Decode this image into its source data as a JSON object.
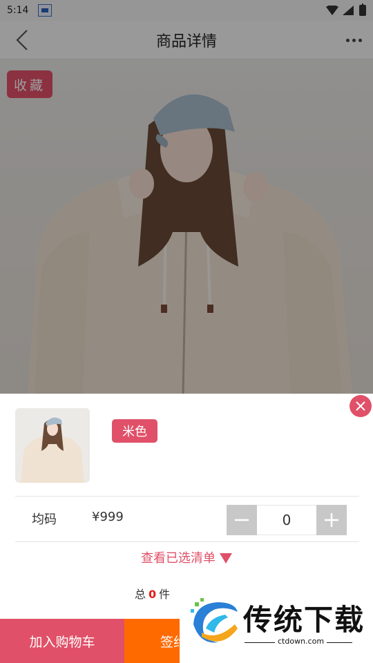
{
  "status_bar": {
    "time": "5:14"
  },
  "nav": {
    "title": "商品详情"
  },
  "hero": {
    "favorite_label": "收藏"
  },
  "sheet": {
    "color_option": "米色",
    "size": "均码",
    "price": "¥999",
    "quantity": "0",
    "view_selected": "查看已选清单",
    "total_prefix": "总",
    "total_count": "0",
    "total_suffix": "件"
  },
  "buttons": {
    "add_to_cart": "加入购物车",
    "sign_partial": "签约"
  },
  "watermark": {
    "title": "传统下载",
    "url": "ctdown.com"
  },
  "colors": {
    "accent": "#e05068",
    "orange": "#ff6a00",
    "count_red": "#e21b1b"
  }
}
